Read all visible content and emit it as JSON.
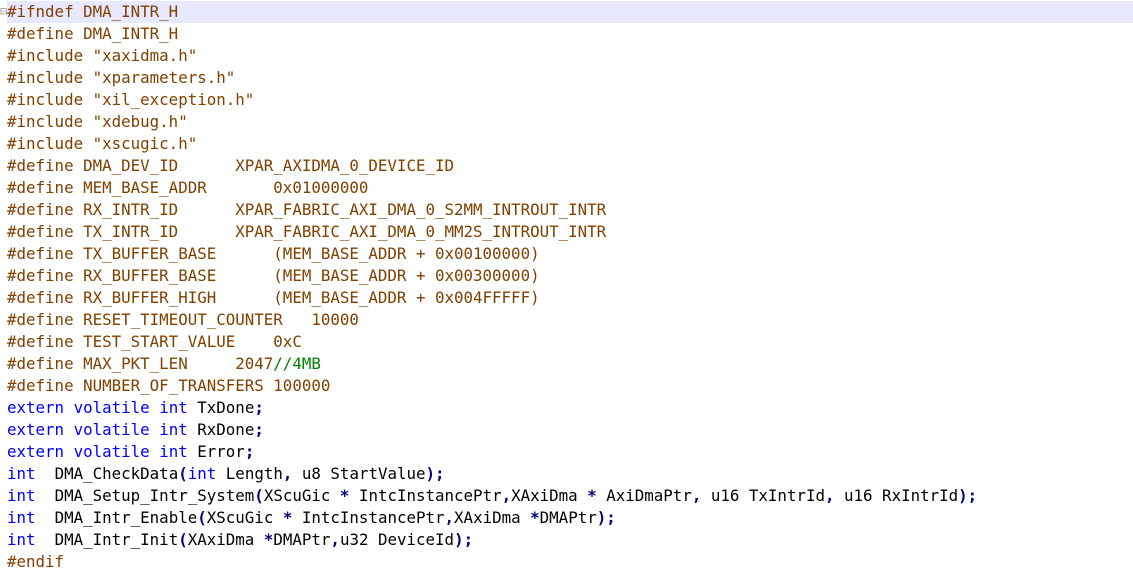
{
  "editor": {
    "fold_marker": "⊟",
    "current_line": 0,
    "colors": {
      "preprocessor": "#804000",
      "keyword": "#0000ff",
      "identifier": "#000000",
      "string": "#808080",
      "operator": "#000080",
      "number": "#ff8000",
      "comment": "#008000",
      "current_line_bg": "#e8e8ff"
    },
    "lines": [
      [
        [
          "pre",
          "#ifndef DMA_INTR_H"
        ]
      ],
      [
        [
          "pre",
          "#define DMA_INTR_H"
        ]
      ],
      [
        [
          "pre",
          "#include \"xaxidma.h\""
        ]
      ],
      [
        [
          "pre",
          "#include \"xparameters.h\""
        ]
      ],
      [
        [
          "pre",
          "#include \"xil_exception.h\""
        ]
      ],
      [
        [
          "pre",
          "#include \"xdebug.h\""
        ]
      ],
      [
        [
          "pre",
          "#include \"xscugic.h\""
        ]
      ],
      [
        [
          "pre",
          "#define DMA_DEV_ID      XPAR_AXIDMA_0_DEVICE_ID"
        ]
      ],
      [
        [
          "pre",
          "#define MEM_BASE_ADDR       0x01000000"
        ]
      ],
      [
        [
          "pre",
          "#define RX_INTR_ID      XPAR_FABRIC_AXI_DMA_0_S2MM_INTROUT_INTR"
        ]
      ],
      [
        [
          "pre",
          "#define TX_INTR_ID      XPAR_FABRIC_AXI_DMA_0_MM2S_INTROUT_INTR"
        ]
      ],
      [
        [
          "pre",
          "#define TX_BUFFER_BASE      (MEM_BASE_ADDR + 0x00100000)"
        ]
      ],
      [
        [
          "pre",
          "#define RX_BUFFER_BASE      (MEM_BASE_ADDR + 0x00300000)"
        ]
      ],
      [
        [
          "pre",
          "#define RX_BUFFER_HIGH      (MEM_BASE_ADDR + 0x004FFFFF)"
        ]
      ],
      [
        [
          "pre",
          "#define RESET_TIMEOUT_COUNTER   10000"
        ]
      ],
      [
        [
          "pre",
          "#define TEST_START_VALUE    0xC"
        ]
      ],
      [
        [
          "pre",
          "#define MAX_PKT_LEN     2047"
        ],
        [
          "cmt",
          "//4MB"
        ]
      ],
      [
        [
          "pre",
          "#define NUMBER_OF_TRANSFERS 100000"
        ]
      ],
      [
        [
          "kw",
          "extern"
        ],
        [
          "id",
          " "
        ],
        [
          "kw",
          "volatile"
        ],
        [
          "id",
          " "
        ],
        [
          "kw",
          "int"
        ],
        [
          "id",
          " TxDone"
        ],
        [
          "op",
          ";"
        ]
      ],
      [
        [
          "kw",
          "extern"
        ],
        [
          "id",
          " "
        ],
        [
          "kw",
          "volatile"
        ],
        [
          "id",
          " "
        ],
        [
          "kw",
          "int"
        ],
        [
          "id",
          " RxDone"
        ],
        [
          "op",
          ";"
        ]
      ],
      [
        [
          "kw",
          "extern"
        ],
        [
          "id",
          " "
        ],
        [
          "kw",
          "volatile"
        ],
        [
          "id",
          " "
        ],
        [
          "kw",
          "int"
        ],
        [
          "id",
          " Error"
        ],
        [
          "op",
          ";"
        ]
      ],
      [
        [
          "kw",
          "int"
        ],
        [
          "id",
          "  DMA_CheckData"
        ],
        [
          "op",
          "("
        ],
        [
          "kw",
          "int"
        ],
        [
          "id",
          " Length"
        ],
        [
          "op",
          ","
        ],
        [
          "id",
          " u8 StartValue"
        ],
        [
          "op",
          ");"
        ]
      ],
      [
        [
          "kw",
          "int"
        ],
        [
          "id",
          "  DMA_Setup_Intr_System"
        ],
        [
          "op",
          "("
        ],
        [
          "id",
          "XScuGic "
        ],
        [
          "op",
          "*"
        ],
        [
          "id",
          " IntcInstancePtr"
        ],
        [
          "op",
          ","
        ],
        [
          "id",
          "XAxiDma "
        ],
        [
          "op",
          "*"
        ],
        [
          "id",
          " AxiDmaPtr"
        ],
        [
          "op",
          ","
        ],
        [
          "id",
          " u16 TxIntrId"
        ],
        [
          "op",
          ","
        ],
        [
          "id",
          " u16 RxIntrId"
        ],
        [
          "op",
          ");"
        ]
      ],
      [
        [
          "kw",
          "int"
        ],
        [
          "id",
          "  DMA_Intr_Enable"
        ],
        [
          "op",
          "("
        ],
        [
          "id",
          "XScuGic "
        ],
        [
          "op",
          "*"
        ],
        [
          "id",
          " IntcInstancePtr"
        ],
        [
          "op",
          ","
        ],
        [
          "id",
          "XAxiDma "
        ],
        [
          "op",
          "*"
        ],
        [
          "id",
          "DMAPtr"
        ],
        [
          "op",
          ");"
        ]
      ],
      [
        [
          "kw",
          "int"
        ],
        [
          "id",
          "  DMA_Intr_Init"
        ],
        [
          "op",
          "("
        ],
        [
          "id",
          "XAxiDma "
        ],
        [
          "op",
          "*"
        ],
        [
          "id",
          "DMAPtr"
        ],
        [
          "op",
          ","
        ],
        [
          "id",
          "u32 DeviceId"
        ],
        [
          "op",
          ");"
        ]
      ],
      [
        [
          "pre",
          "#endif"
        ]
      ]
    ]
  }
}
